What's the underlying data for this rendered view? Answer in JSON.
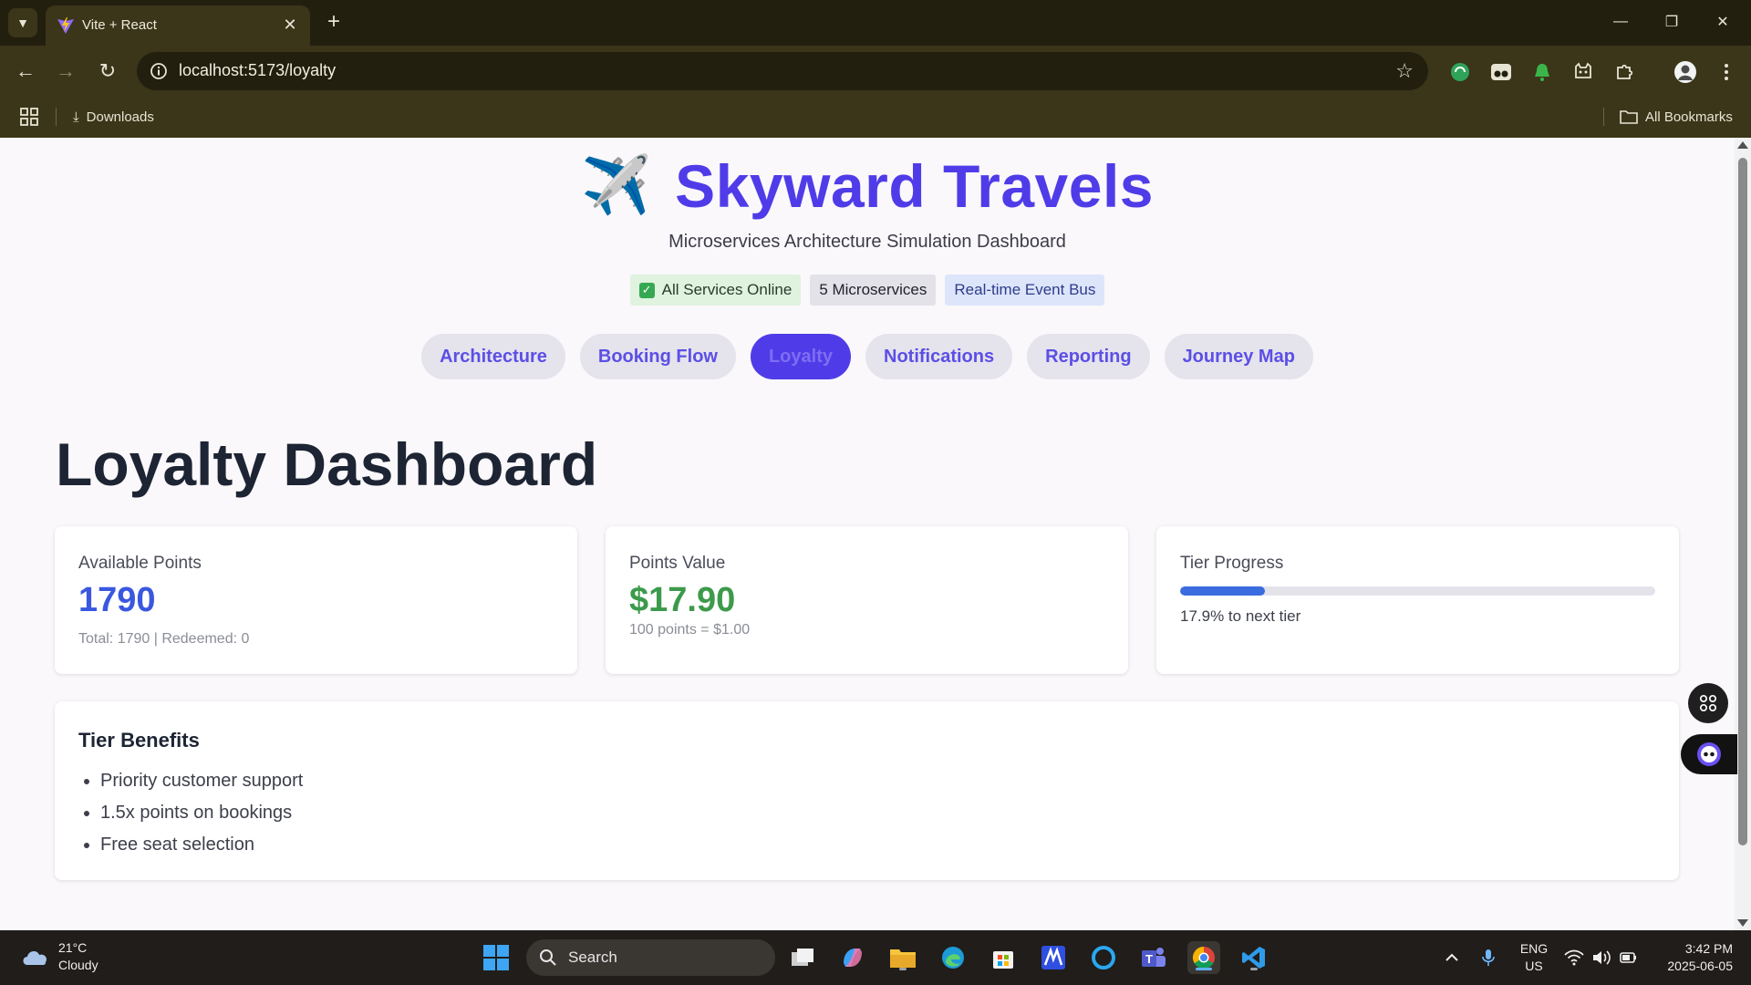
{
  "browser": {
    "tab_title": "Vite + React",
    "url": "localhost:5173/loyalty",
    "bookmarks": {
      "downloads_label": "Downloads",
      "all_bookmarks_label": "All Bookmarks"
    }
  },
  "header": {
    "title": "Skyward Travels",
    "logo_emoji": "✈️",
    "subtitle": "Microservices Architecture Simulation Dashboard",
    "status_pills": [
      {
        "label": "All Services Online"
      },
      {
        "label": "5 Microservices"
      },
      {
        "label": "Real-time Event Bus"
      }
    ]
  },
  "nav": {
    "tabs": [
      {
        "label": "Architecture",
        "active": false
      },
      {
        "label": "Booking Flow",
        "active": false
      },
      {
        "label": "Loyalty",
        "active": true
      },
      {
        "label": "Notifications",
        "active": false
      },
      {
        "label": "Reporting",
        "active": false
      },
      {
        "label": "Journey Map",
        "active": false
      }
    ]
  },
  "main": {
    "heading": "Loyalty Dashboard",
    "cards": {
      "available_points": {
        "label": "Available Points",
        "value": "1790",
        "detail": "Total: 1790 | Redeemed: 0"
      },
      "points_value": {
        "label": "Points Value",
        "value": "$17.90",
        "detail": "100 points = $1.00"
      },
      "tier_progress": {
        "label": "Tier Progress",
        "progress_percent": 17.9,
        "text": "17.9% to next tier"
      }
    },
    "benefits": {
      "title": "Tier Benefits",
      "items": [
        "Priority customer support",
        "1.5x points on bookings",
        "Free seat selection"
      ]
    }
  },
  "taskbar": {
    "weather_temp": "21°C",
    "weather_desc": "Cloudy",
    "search_label": "Search",
    "lang_top": "ENG",
    "lang_bottom": "US",
    "time": "3:42 PM",
    "date": "2025-06-05"
  },
  "colors": {
    "brand": "#4f3ce8",
    "points_blue": "#3a57e0",
    "value_green": "#3c9a4a",
    "progress": "#3a6ce0"
  }
}
